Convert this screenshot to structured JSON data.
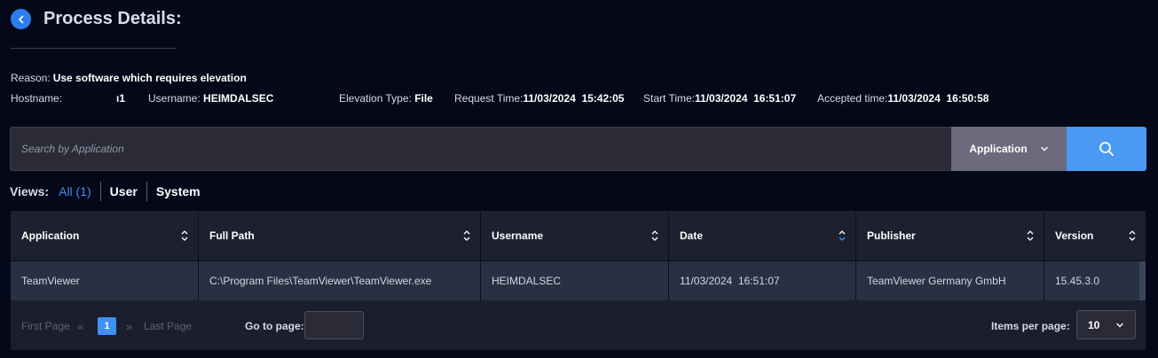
{
  "header": {
    "title": "Process Details:"
  },
  "details": {
    "reason_label": "Reason:",
    "reason_value": "Use software which requires elevation",
    "hostname_label": "Hostname:",
    "hostname_value": "ı1",
    "username_label": "Username:",
    "username_value": "HEIMDALSEC",
    "elevation_label": "Elevation Type:",
    "elevation_value": "File",
    "request_label": "Request Time:",
    "request_value": "11/03/2024  15:42:05",
    "start_label": "Start Time:",
    "start_value": "11/03/2024  16:51:07",
    "accepted_label": "Accepted time:",
    "accepted_value": "11/03/2024  16:50:58"
  },
  "search": {
    "placeholder": "Search by Application",
    "value": "",
    "scope": "Application"
  },
  "views": {
    "label": "Views:",
    "options": [
      "All (1)",
      "User",
      "System"
    ],
    "selected": "All (1)"
  },
  "table": {
    "columns": [
      "Application",
      "Full Path",
      "Username",
      "Date",
      "Publisher",
      "Version"
    ],
    "rows": [
      [
        "TeamViewer",
        "C:\\Program Files\\TeamViewer\\TeamViewer.exe",
        "HEIMDALSEC",
        "11/03/2024  16:51:07",
        "TeamViewer Germany GmbH",
        "15.45.3.0"
      ]
    ]
  },
  "pagination": {
    "first_label": "First Page",
    "last_label": "Last Page",
    "current_page": "1",
    "goto_label": "Go to page:",
    "goto_value": "",
    "items_per_page_label": "Items per page:",
    "items_per_page": "10"
  },
  "colors": {
    "background": "#050818",
    "accent": "#3e90f2",
    "search_button": "#4a9af4",
    "header_row": "#1d202f",
    "data_row": "#273142"
  }
}
